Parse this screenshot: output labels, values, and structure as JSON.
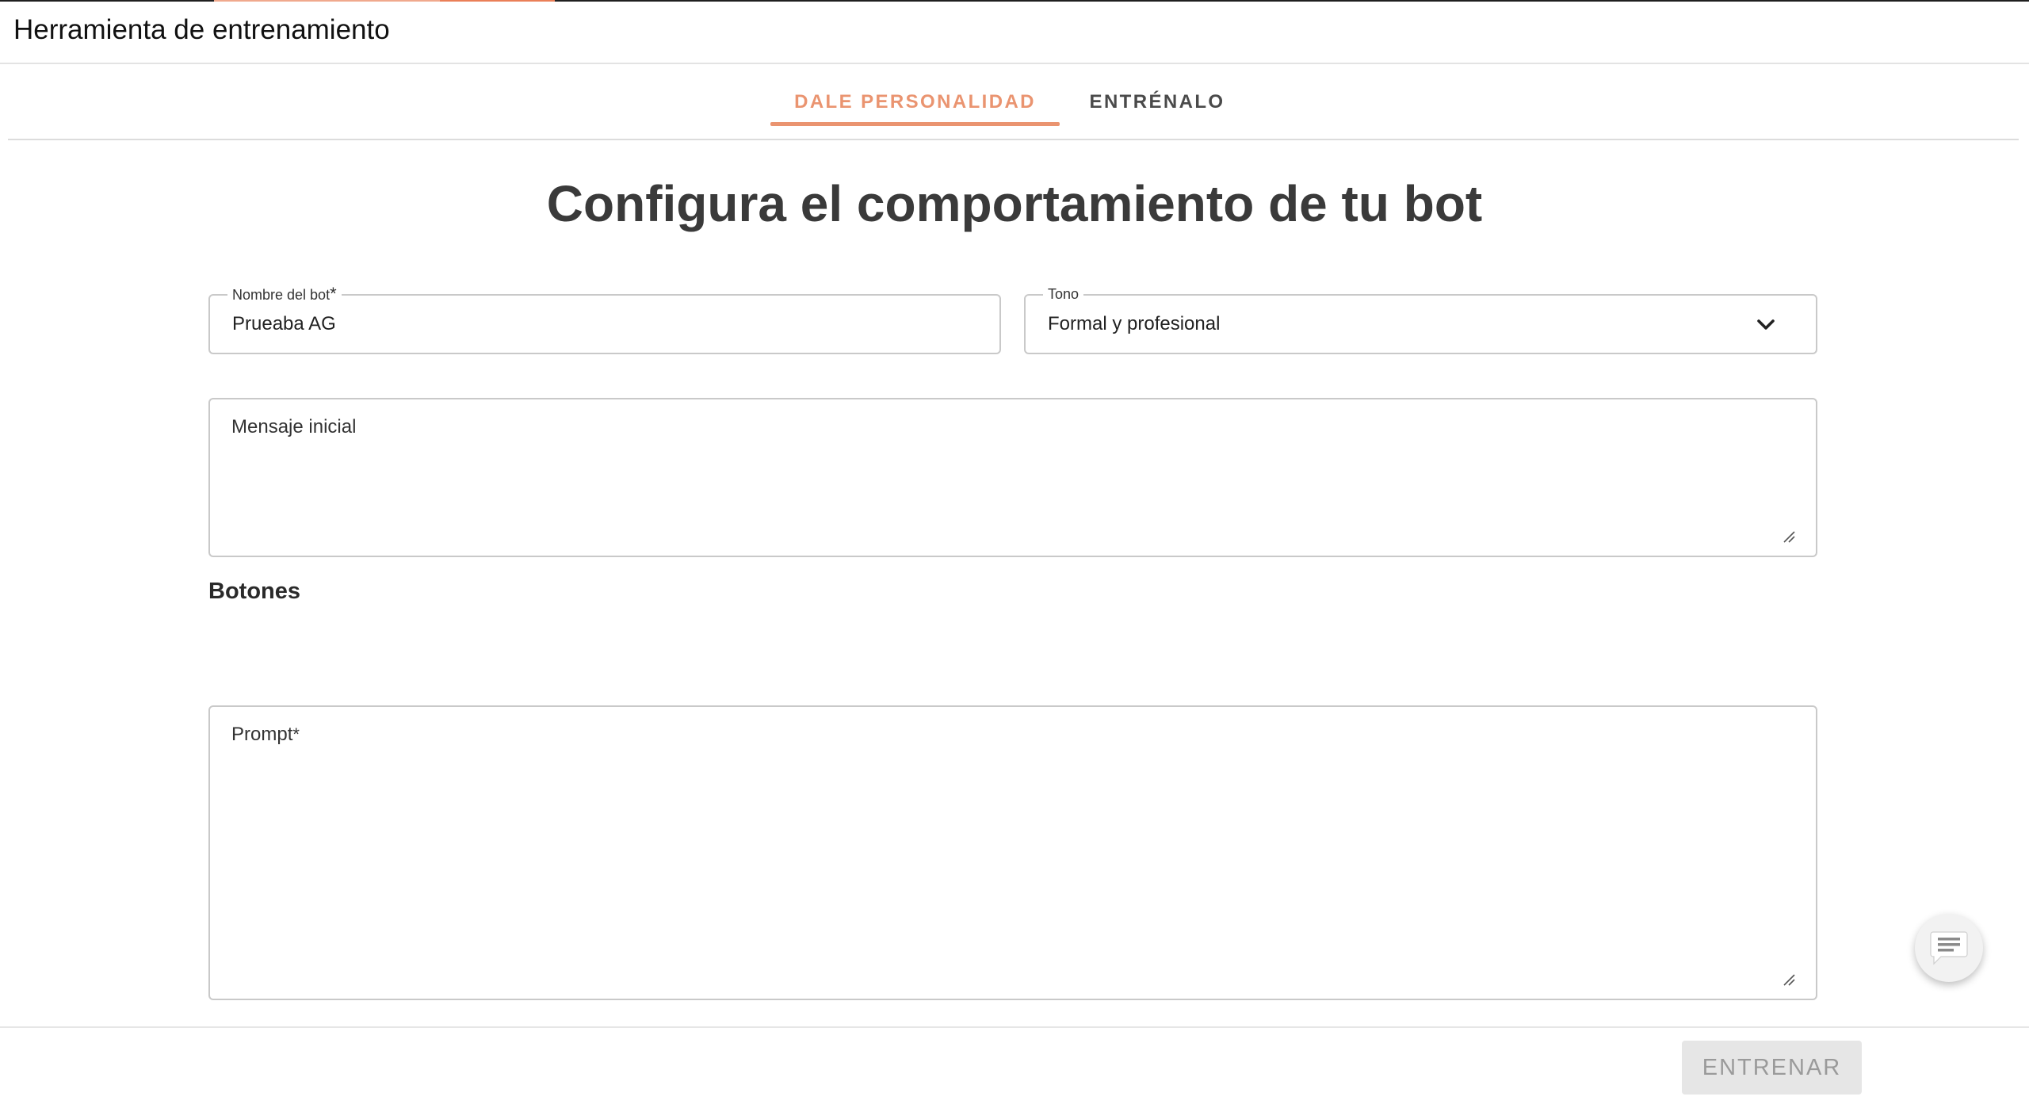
{
  "app": {
    "title": "Herramienta de entrenamiento"
  },
  "tabs": [
    {
      "label": "DALE PERSONALIDAD",
      "active": true
    },
    {
      "label": "ENTRÉNALO",
      "active": false
    }
  ],
  "page": {
    "title": "Configura el comportamiento de tu bot"
  },
  "form": {
    "bot_name": {
      "label": "Nombre del bot",
      "required_mark": "*",
      "value": "Prueaba AG"
    },
    "tone": {
      "label": "Tono",
      "value": "Formal y profesional"
    },
    "initial_message": {
      "label": "Mensaje inicial",
      "value": ""
    },
    "buttons_section": {
      "label": "Botones"
    },
    "prompt": {
      "label": "Prompt",
      "required_mark": "*",
      "value": ""
    }
  },
  "footer": {
    "train_label": "ENTRENAR",
    "train_disabled": true
  },
  "icons": {
    "tone_dropdown": "chevron-down-icon",
    "chat": "chat-bubble-icon",
    "resize": "resize-handle-icon"
  },
  "colors": {
    "accent": "#ea9470",
    "title_text": "#3a3a3a",
    "disabled_button_bg": "#e6e6e6"
  }
}
